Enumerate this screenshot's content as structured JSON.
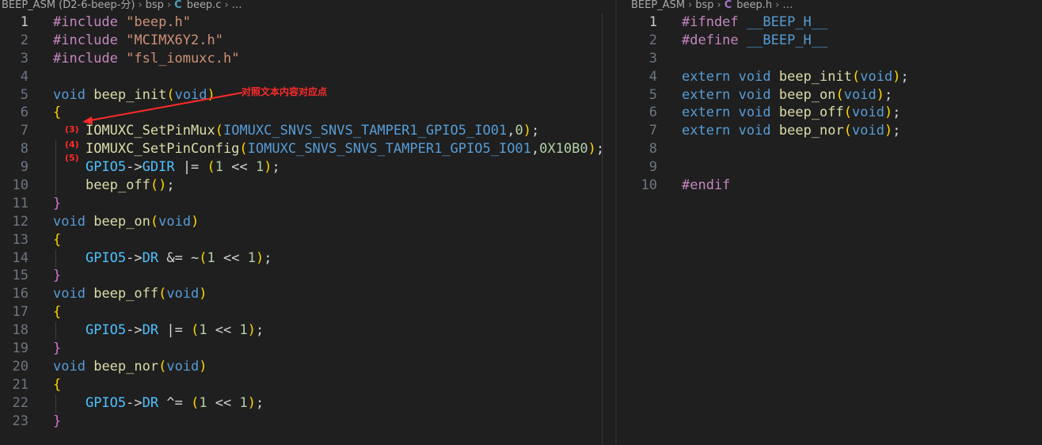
{
  "left": {
    "breadcrumb": {
      "project": "BEEP_ASM (D2-6-beep-分)",
      "folder": "bsp",
      "file_icon": "C",
      "file": "beep.c",
      "more": "…"
    },
    "lines": [
      {
        "n": "1",
        "t": "#include \"beep.h\""
      },
      {
        "n": "2",
        "t": "#include \"MCIMX6Y2.h\""
      },
      {
        "n": "3",
        "t": "#include \"fsl_iomuxc.h\""
      },
      {
        "n": "4",
        "t": ""
      },
      {
        "n": "5",
        "t": "void beep_init(void)"
      },
      {
        "n": "6",
        "t": "{"
      },
      {
        "n": "7",
        "t": "    IOMUXC_SetPinMux(IOMUXC_SNVS_SNVS_TAMPER1_GPIO5_IO01,0);"
      },
      {
        "n": "8",
        "t": "    IOMUXC_SetPinConfig(IOMUXC_SNVS_SNVS_TAMPER1_GPIO5_IO01,0X10B0);"
      },
      {
        "n": "9",
        "t": "    GPIO5->GDIR |= (1 << 1);"
      },
      {
        "n": "10",
        "t": "    beep_off();"
      },
      {
        "n": "11",
        "t": "}"
      },
      {
        "n": "12",
        "t": "void beep_on(void)"
      },
      {
        "n": "13",
        "t": "{"
      },
      {
        "n": "14",
        "t": "    GPIO5->DR &= ~(1 << 1);"
      },
      {
        "n": "15",
        "t": "}"
      },
      {
        "n": "16",
        "t": "void beep_off(void)"
      },
      {
        "n": "17",
        "t": "{"
      },
      {
        "n": "18",
        "t": "    GPIO5->DR |= (1 << 1);"
      },
      {
        "n": "19",
        "t": "}"
      },
      {
        "n": "20",
        "t": "void beep_nor(void)"
      },
      {
        "n": "21",
        "t": "{"
      },
      {
        "n": "22",
        "t": "    GPIO5->DR ^= (1 << 1);"
      },
      {
        "n": "23",
        "t": "}"
      }
    ],
    "annotation": {
      "note": "对照文本内容对应点",
      "markers": [
        "(3)",
        "(4)",
        "(5)"
      ]
    }
  },
  "right": {
    "breadcrumb": {
      "project": "BEEP_ASM",
      "folder": "bsp",
      "file_icon": "C",
      "file": "beep.h",
      "more": "…"
    },
    "lines": [
      {
        "n": "1",
        "t": "#ifndef __BEEP_H__"
      },
      {
        "n": "2",
        "t": "#define __BEEP_H__"
      },
      {
        "n": "3",
        "t": ""
      },
      {
        "n": "4",
        "t": "extern void beep_init(void);"
      },
      {
        "n": "5",
        "t": "extern void beep_on(void);"
      },
      {
        "n": "6",
        "t": "extern void beep_off(void);"
      },
      {
        "n": "7",
        "t": "extern void beep_nor(void);"
      },
      {
        "n": "8",
        "t": ""
      },
      {
        "n": "9",
        "t": ""
      },
      {
        "n": "10",
        "t": "#endif"
      }
    ]
  },
  "colors": {
    "background": "#1f1f1f",
    "annotation": "#ff2a2a"
  }
}
